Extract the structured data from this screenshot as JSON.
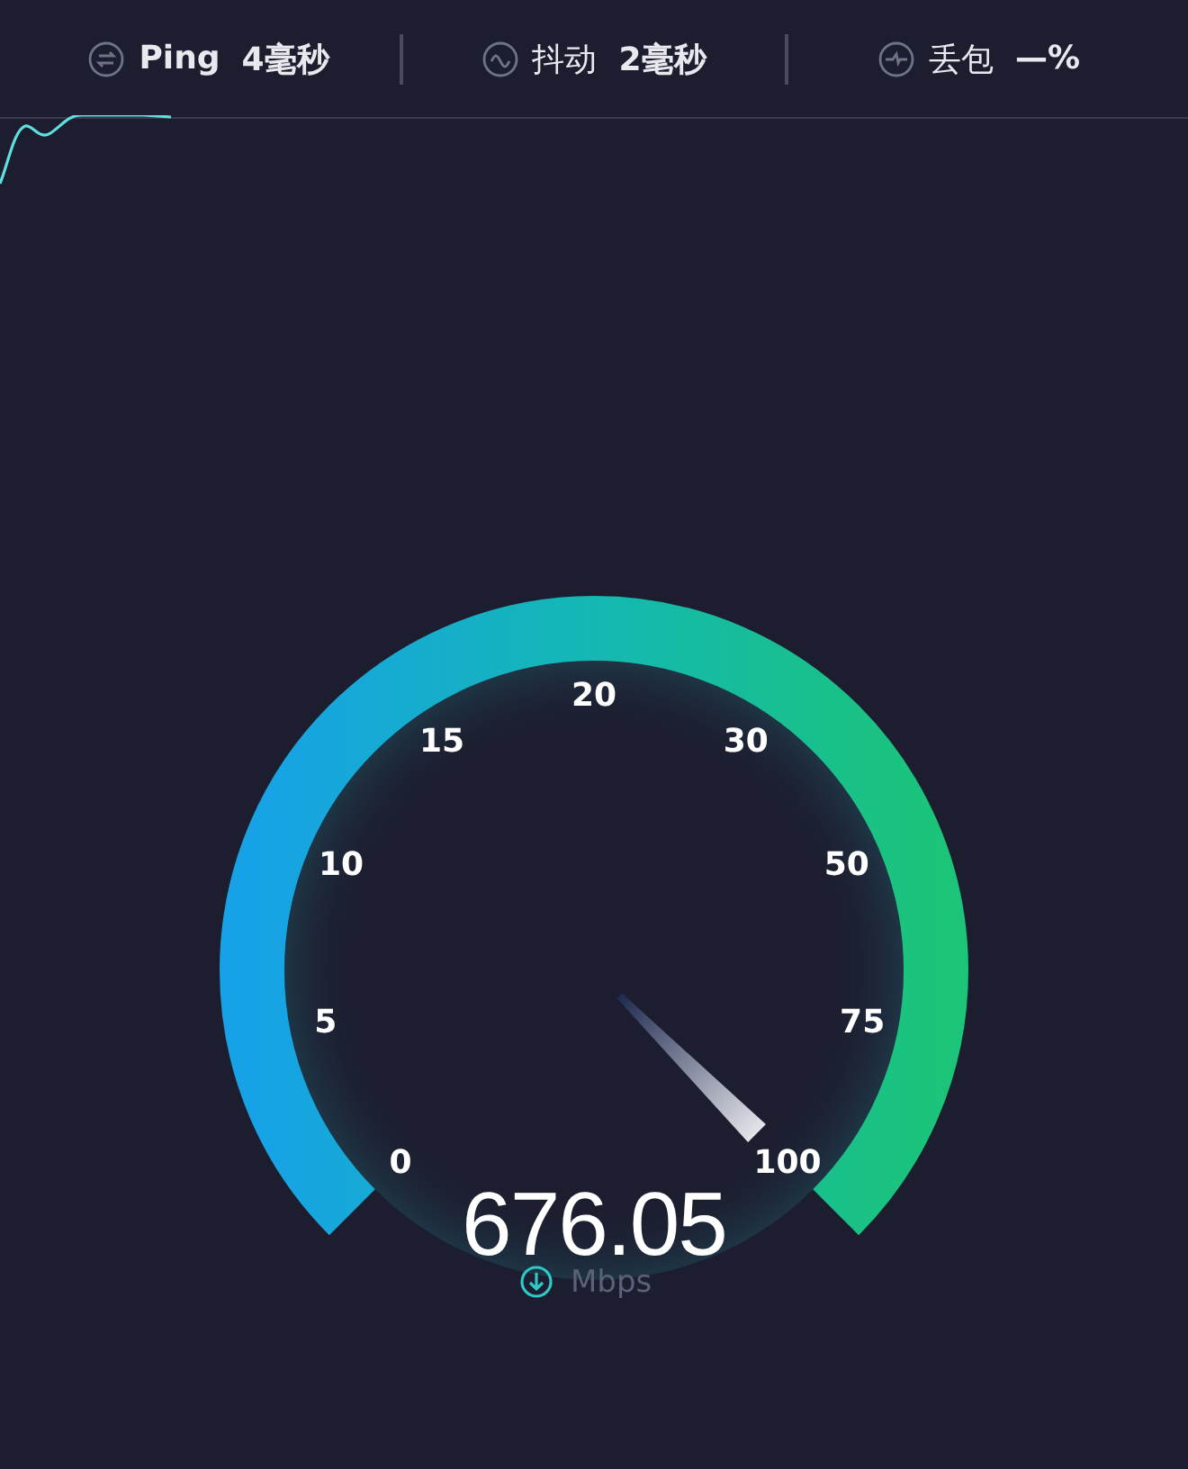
{
  "metrics": [
    {
      "kind": "ping",
      "label": "Ping",
      "value": "4毫秒"
    },
    {
      "kind": "jitter",
      "label": "抖动",
      "value": "2毫秒"
    },
    {
      "kind": "loss",
      "label": "丢包",
      "value": "—%"
    }
  ],
  "gauge": {
    "ticks": [
      "0",
      "5",
      "10",
      "15",
      "20",
      "30",
      "50",
      "75",
      "100"
    ],
    "speed": "676.05",
    "unit": "Mbps"
  }
}
